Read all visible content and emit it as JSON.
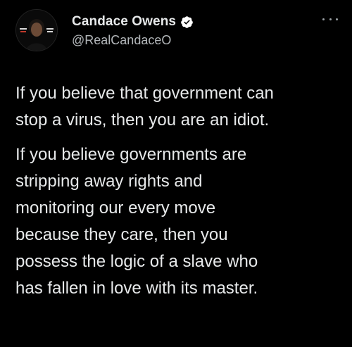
{
  "author": {
    "display_name": "Candace Owens",
    "handle": "@RealCandaceO",
    "verified": true,
    "avatar_icon": "profile-photo"
  },
  "menu": {
    "more_icon": "more-horizontal-icon"
  },
  "tweet": {
    "paragraphs": [
      [
        "If you believe that government can",
        "stop a virus, then you are an idiot."
      ],
      [
        "If you believe governments are",
        "stripping away rights and",
        "monitoring our every move",
        "because they care, then you",
        "possess the logic of a slave who",
        "has fallen in love with its master."
      ]
    ]
  },
  "colors": {
    "background": "#000000",
    "text": "#e7e9ea",
    "secondary_text": "#b3b7ba",
    "verified_badge": "#ffffff"
  }
}
